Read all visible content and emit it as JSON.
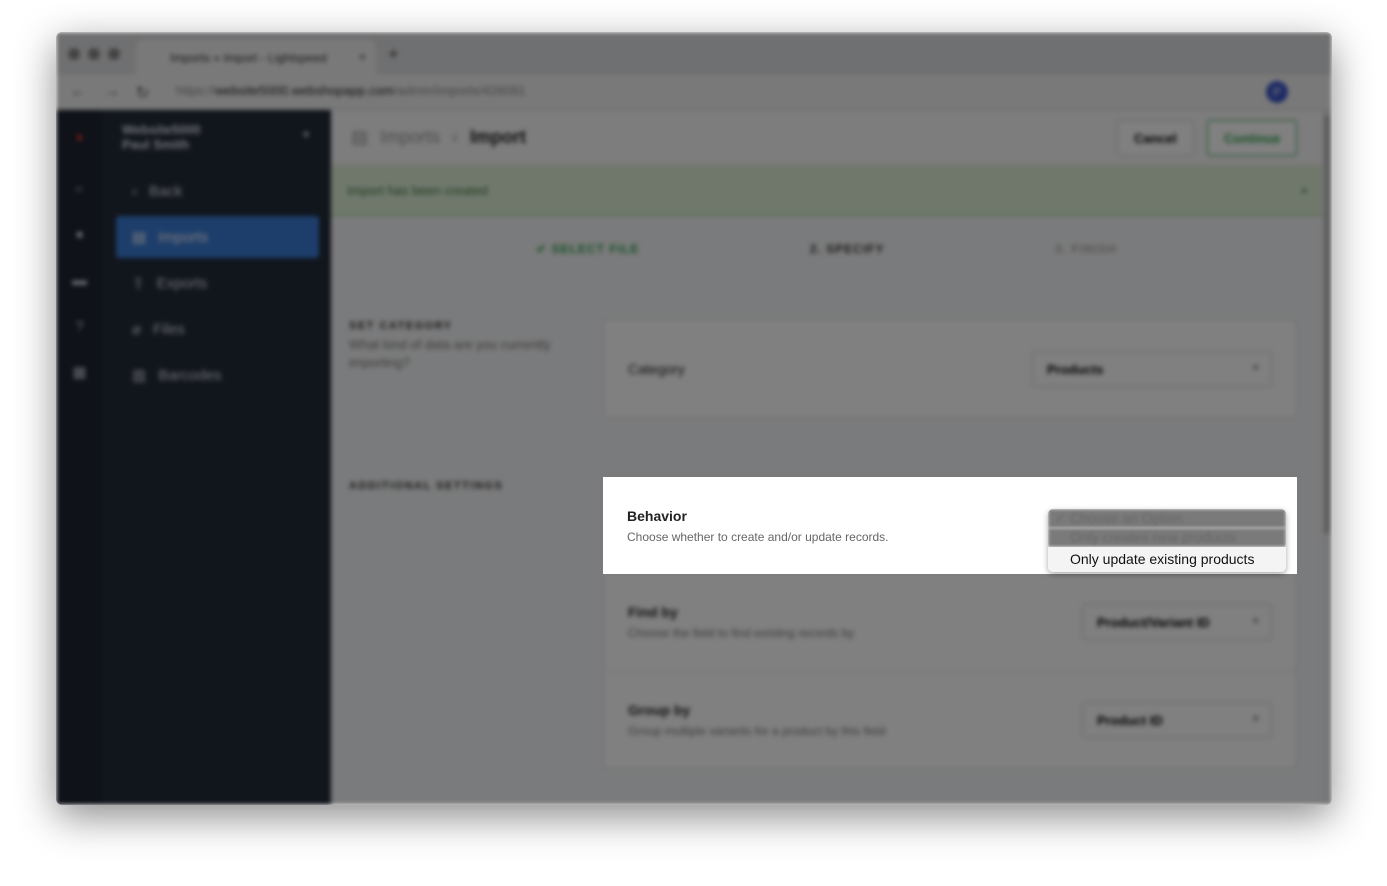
{
  "browser": {
    "tab_title": "Imports » Import - Lightspeed",
    "url_host": "website5000.webshopapp.com",
    "url_prefix": "https://",
    "url_path": "/admin/imports/426091",
    "avatar": "P"
  },
  "sidebar": {
    "shop": "Website5000",
    "user": "Paul Smith",
    "items": [
      {
        "label": "Back",
        "icon": "chevron-left"
      },
      {
        "label": "Imports",
        "icon": "file"
      },
      {
        "label": "Exports",
        "icon": "export"
      },
      {
        "label": "Files",
        "icon": "paperclip"
      },
      {
        "label": "Barcodes",
        "icon": "barcode"
      }
    ]
  },
  "header": {
    "crumb_parent": "Imports",
    "crumb_current": "Import",
    "cancel": "Cancel",
    "continue": "Continue"
  },
  "banner": "Import has been created",
  "steps": [
    "SELECT FILE",
    "2. SPECIFY",
    "3. FINISH"
  ],
  "set_category": {
    "title": "SET CATEGORY",
    "desc": "What kind of data are you currently importing?",
    "label": "Category",
    "value": "Products"
  },
  "additional": {
    "title": "ADDITIONAL SETTINGS",
    "behavior": {
      "label": "Behavior",
      "desc": "Choose whether to create and/or update records.",
      "options": [
        "Choose an Option",
        "Only creates new products",
        "Only update existing products"
      ],
      "checked": "Choose an Option",
      "highlighted": "Only update existing products"
    },
    "find_by": {
      "label": "Find by",
      "desc": "Choose the field to find existing records by",
      "value": "Product/Variant ID"
    },
    "group_by": {
      "label": "Group by",
      "desc": "Group multiple variants for a product by this field",
      "value": "Product ID"
    }
  }
}
